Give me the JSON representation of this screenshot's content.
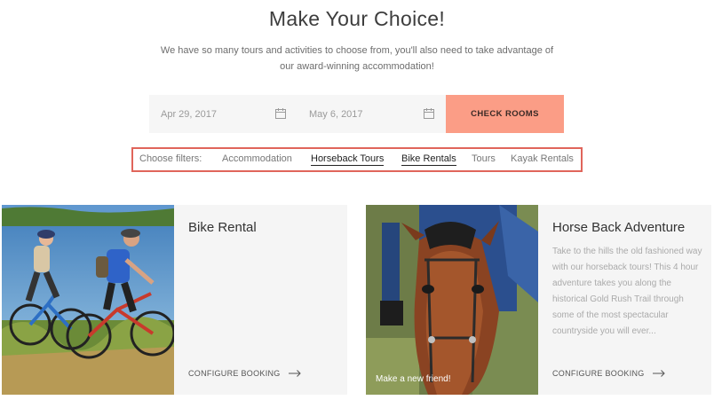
{
  "header": {
    "title": "Make Your Choice!",
    "subtitle": "We have so many tours and activities to choose from, you'll also need to take advantage of our award-winning accommodation!"
  },
  "booking": {
    "date_from": "Apr 29, 2017",
    "date_to": "May 6, 2017",
    "check_label": "CHECK ROOMS",
    "accent_color": "#fb9d86"
  },
  "filters": {
    "label": "Choose filters:",
    "items": [
      {
        "label": "Accommodation",
        "active": false
      },
      {
        "label": "Horseback Tours",
        "active": true
      },
      {
        "label": "Bike Rentals",
        "active": true
      },
      {
        "label": "Tours",
        "active": false
      },
      {
        "label": "Kayak Rentals",
        "active": false
      }
    ],
    "highlight_color": "#e0655b"
  },
  "cards": [
    {
      "title": "Bike Rental",
      "description": "",
      "cta": "CONFIGURE BOOKING",
      "caption": ""
    },
    {
      "title": "Horse Back Adventure",
      "description": "Take to the hills the old fashioned way with our horseback tours! This 4 hour adventure takes you along the historical Gold Rush Trail through some of the most spectacular countryside you will ever...",
      "cta": "CONFIGURE BOOKING",
      "caption": "Make a new friend!"
    }
  ]
}
